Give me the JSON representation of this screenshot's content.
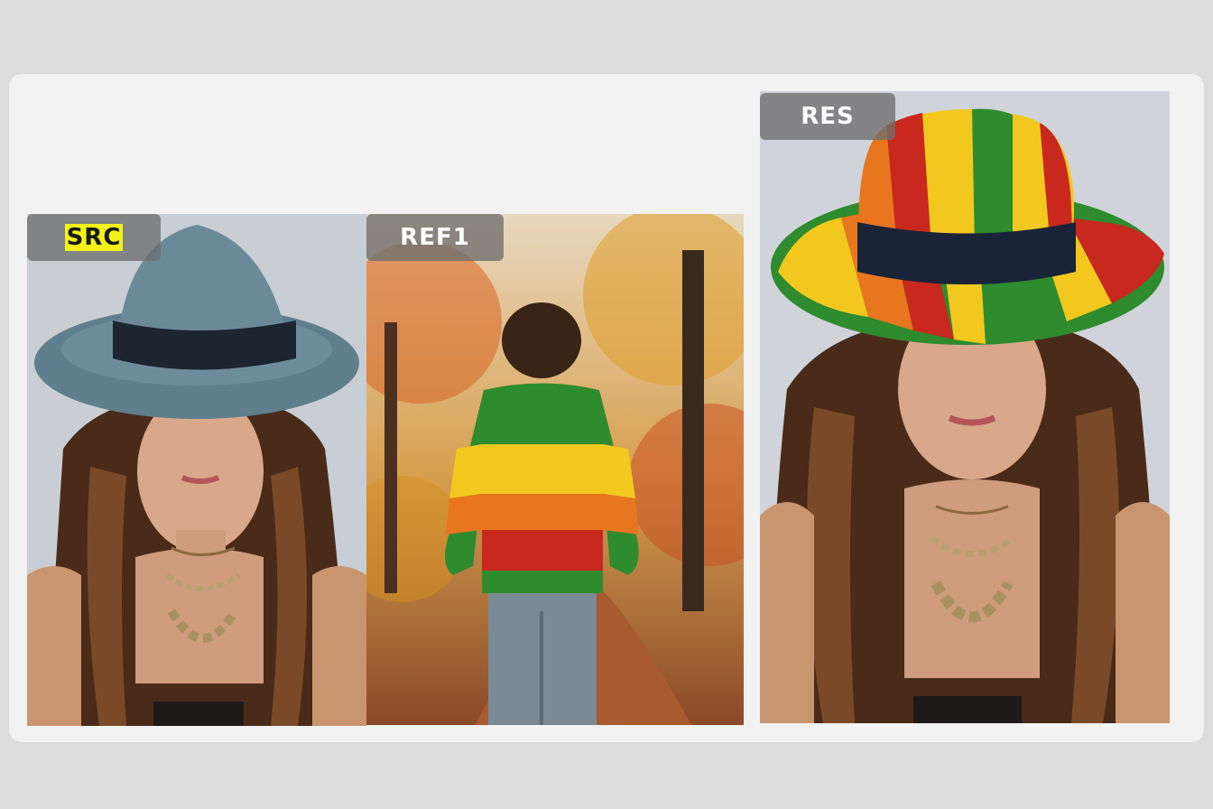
{
  "panels": {
    "src": {
      "label": "SRC",
      "subject": "woman-gray-fedora"
    },
    "ref": {
      "label": "REF1",
      "subject": "person-striped-sweater-autumn-path"
    },
    "res": {
      "label": "RES",
      "subject": "woman-striped-fedora"
    }
  },
  "colors": {
    "background": "#dcdcdc",
    "card": "#f2f2f2",
    "label_bg": "#6e6e6e",
    "label_highlight": "#f2f21a",
    "stripe_green": "#2e8b2e",
    "stripe_yellow": "#f2c81e",
    "stripe_orange": "#e8761e",
    "stripe_red": "#c8281e",
    "gray_hat": "#5f7f8e"
  }
}
